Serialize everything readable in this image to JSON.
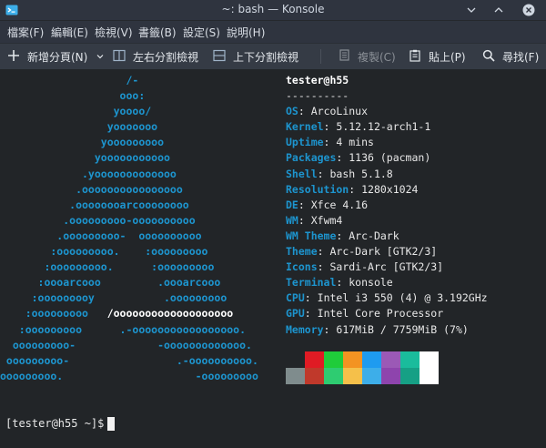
{
  "window": {
    "title": "~: bash — Konsole"
  },
  "menubar": {
    "items": [
      "檔案(F)",
      "編輯(E)",
      "檢視(V)",
      "書籤(B)",
      "設定(S)",
      "說明(H)"
    ]
  },
  "toolbar": {
    "new_tab": "新增分頁(N)",
    "split_lr": "左右分割檢視",
    "split_tb": "上下分割檢視",
    "copy": "複製(C)",
    "paste": "貼上(P)",
    "find": "尋找(F)"
  },
  "neofetch": {
    "header": "tester@h55",
    "separator": "----------",
    "fields": [
      {
        "key": "OS",
        "value": "ArcoLinux"
      },
      {
        "key": "Kernel",
        "value": "5.12.12-arch1-1"
      },
      {
        "key": "Uptime",
        "value": "4 mins"
      },
      {
        "key": "Packages",
        "value": "1136 (pacman)"
      },
      {
        "key": "Shell",
        "value": "bash 5.1.8"
      },
      {
        "key": "Resolution",
        "value": "1280x1024"
      },
      {
        "key": "DE",
        "value": "Xfce 4.16"
      },
      {
        "key": "WM",
        "value": "Xfwm4"
      },
      {
        "key": "WM Theme",
        "value": "Arc-Dark"
      },
      {
        "key": "Theme",
        "value": "Arc-Dark [GTK2/3]"
      },
      {
        "key": "Icons",
        "value": "Sardi-Arc [GTK2/3]"
      },
      {
        "key": "Terminal",
        "value": "konsole"
      },
      {
        "key": "CPU",
        "value": "Intel i3 550 (4) @ 3.192GHz"
      },
      {
        "key": "GPU",
        "value": "Intel Core Processor"
      },
      {
        "key": "Memory",
        "value": "617MiB / 7759MiB (7%)"
      }
    ],
    "palette_top": [
      "#222528",
      "#e01b24",
      "#1fcc3a",
      "#f39322",
      "#1e9bf0",
      "#9b59b6",
      "#1abc9c",
      "#ffffff"
    ],
    "palette_bottom": [
      "#7f8c8d",
      "#c0392b",
      "#2ecc71",
      "#f5c04a",
      "#3daee9",
      "#8e44ad",
      "#16a085",
      "#ffffff"
    ]
  },
  "terminal": {
    "prompt": "[tester@h55 ~]$"
  },
  "colors": {
    "accent": "#1d95cf",
    "background": "#222528",
    "text": "#e8e8e8"
  }
}
